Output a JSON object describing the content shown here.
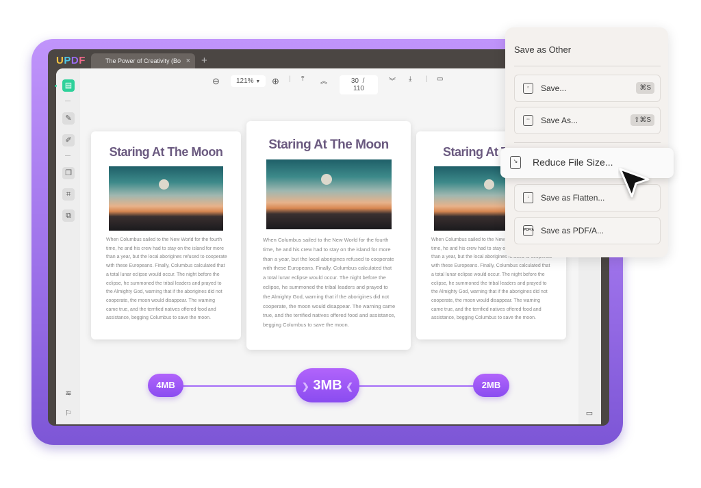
{
  "app": {
    "logo": "UPDF",
    "tab_title": "The Power of Creativity (Bo",
    "tab_close": "×",
    "new_tab": "+"
  },
  "toolbar": {
    "zoom": "121%",
    "current_page": "30",
    "page_sep": "/",
    "total_pages": "110"
  },
  "pages": [
    {
      "title": "Staring At The Moon",
      "body": "When Columbus sailed to the New World for the fourth time, he and his crew had to stay on the island for more than a year, but the local aborigines refused to cooperate with these Europeans. Finally, Columbus calculated that a total lunar eclipse would occur. The night before the eclipse, he summoned the tribal leaders and prayed to the Almighty God, warning that if the aborigines did not cooperate, the moon would disappear. The warning came true, and the terrified natives offered food and assistance, begging Columbus to save the moon."
    },
    {
      "title": "Staring At The Moon",
      "body": "When Columbus sailed to the New World for the fourth time, he and his crew had to stay on the island for more than a year, but the local aborigines refused to cooperate with these Europeans. Finally, Columbus calculated that a total lunar eclipse would occur. The night before the eclipse, he summoned the tribal leaders and prayed to the Almighty God, warning that if the aborigines did not cooperate, the moon would disappear. The warning came true, and the terrified natives offered food and assistance, begging Columbus to save the moon."
    },
    {
      "title": "Staring At The Moon",
      "body": "When Columbus sailed to the New World for the fourth time, he and his crew had to stay on the island for more than a year, but the local aborigines refused to cooperate with these Europeans. Finally, Columbus calculated that a total lunar eclipse would occur. The night before the eclipse, he summoned the tribal leaders and prayed to the Almighty God, warning that if the aborigines did not cooperate, the moon would disappear. The warning came true, and the terrified natives offered food and assistance, begging Columbus to save the moon."
    }
  ],
  "menu": {
    "title": "Save as Other",
    "items": [
      {
        "label": "Save...",
        "shortcut": "⌘S",
        "icon": "save-icon"
      },
      {
        "label": "Save As...",
        "shortcut": "⇧⌘S",
        "icon": "save-as-icon"
      },
      {
        "label": "Reduce File Size...",
        "icon": "reduce-file-size-icon"
      },
      {
        "label": "Save as Flatten...",
        "icon": "flatten-icon"
      },
      {
        "label": "Save as PDF/A...",
        "icon": "pdfa-icon",
        "icon_text": "PDF/A"
      }
    ]
  },
  "size_slider": {
    "options": [
      "4MB",
      "3MB",
      "2MB"
    ],
    "selected": "3MB"
  },
  "colors": {
    "accent": "#9b5cf6",
    "frame": "#a47cf0",
    "window": "#4b4643",
    "active_tool": "#2ed19a"
  }
}
